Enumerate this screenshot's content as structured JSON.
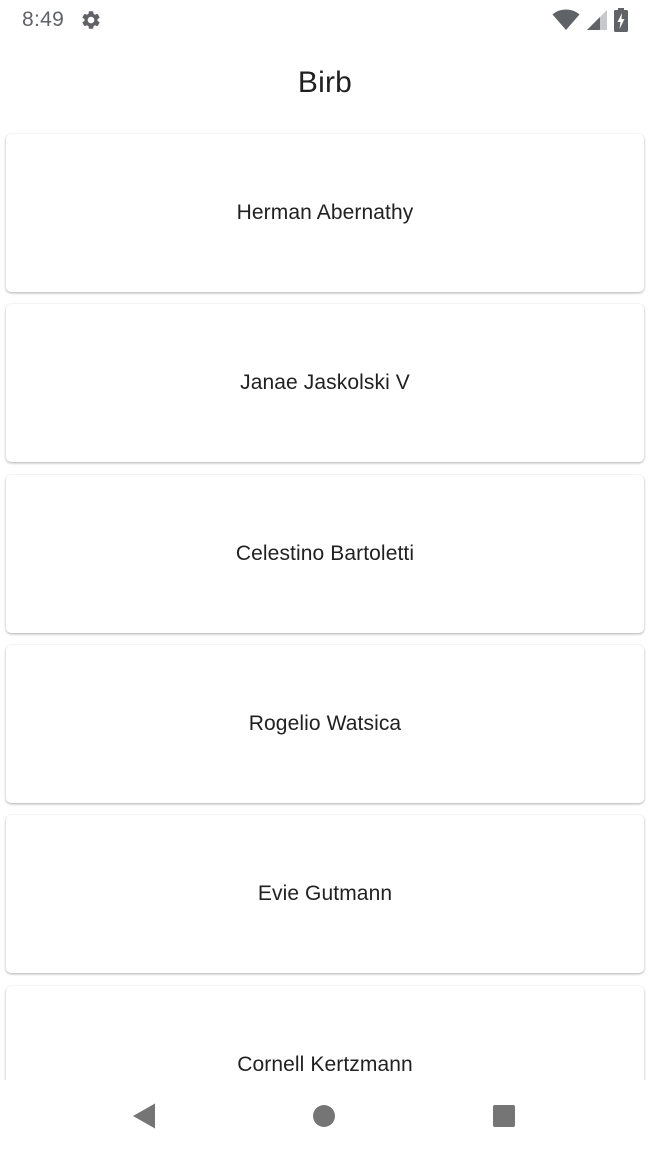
{
  "status_bar": {
    "time": "8:49",
    "icons": [
      "settings-icon",
      "wifi-icon",
      "cellular-signal-icon",
      "battery-charging-icon"
    ]
  },
  "app_bar": {
    "title": "Birb"
  },
  "list": {
    "items": [
      {
        "name": "Herman Abernathy"
      },
      {
        "name": "Janae Jaskolski V"
      },
      {
        "name": "Celestino Bartoletti"
      },
      {
        "name": "Rogelio Watsica"
      },
      {
        "name": "Evie Gutmann"
      },
      {
        "name": "Cornell Kertzmann"
      }
    ]
  },
  "nav_bar": {
    "buttons": [
      "back-icon",
      "home-icon",
      "recents-icon"
    ]
  },
  "colors": {
    "background": "#ffffff",
    "text_primary": "#212121",
    "status_icons": "#5f6368",
    "nav_icons": "#757575"
  }
}
